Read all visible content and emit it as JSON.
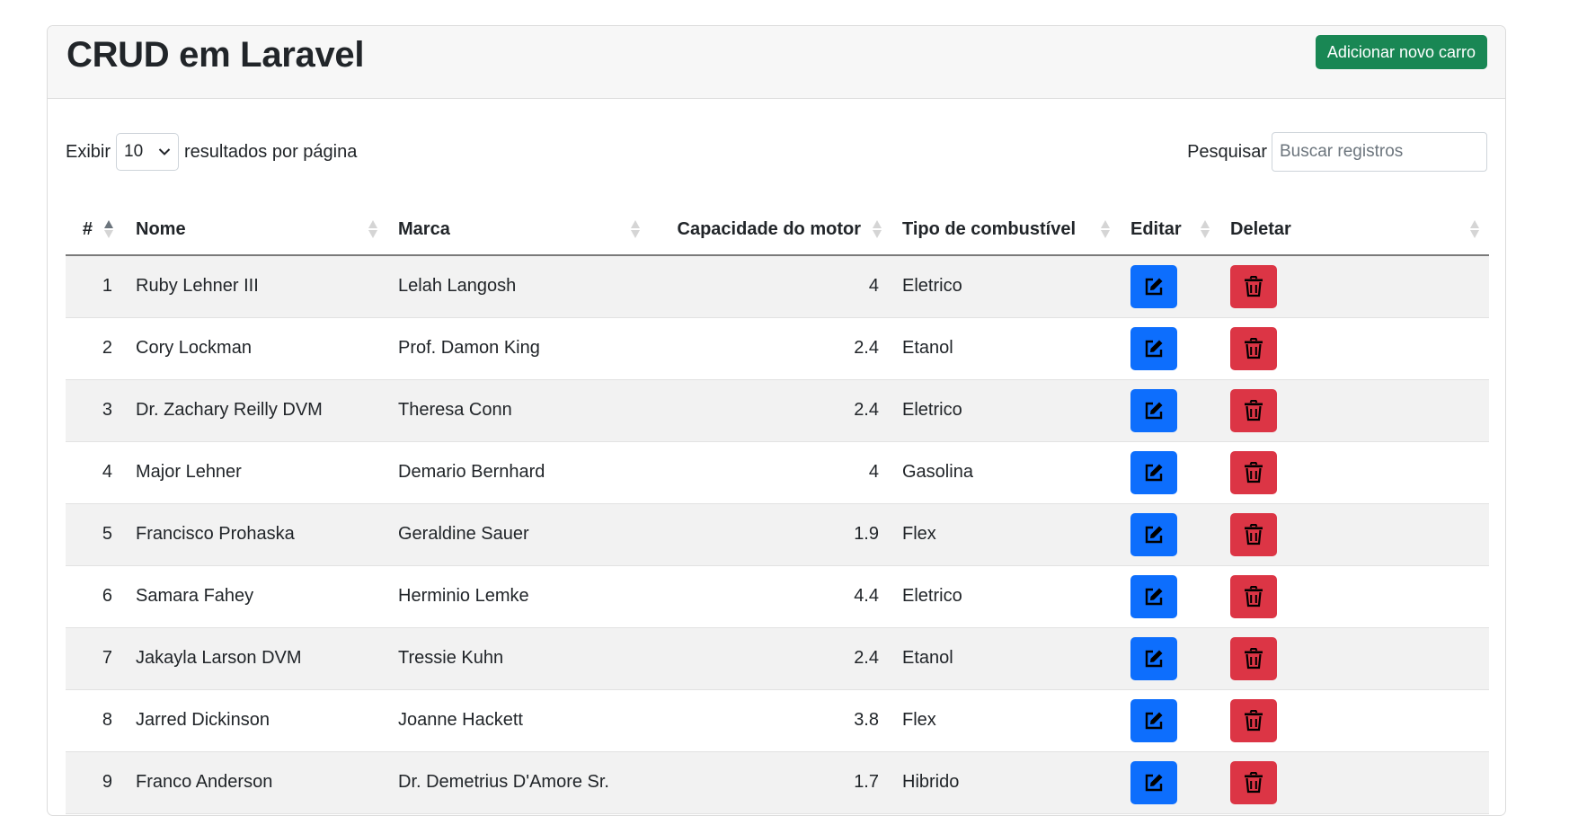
{
  "header": {
    "title": "CRUD em Laravel",
    "add_label": "Adicionar novo carro"
  },
  "controls": {
    "show_prefix": "Exibir",
    "page_length": "10",
    "show_suffix": "resultados por página",
    "search_label": "Pesquisar",
    "search_placeholder": "Buscar registros"
  },
  "table": {
    "columns": [
      "#",
      "Nome",
      "Marca",
      "Capacidade do motor",
      "Tipo de combustível",
      "Editar",
      "Deletar"
    ],
    "rows": [
      [
        "1",
        "Ruby Lehner III",
        "Lelah Langosh",
        "4",
        "Eletrico"
      ],
      [
        "2",
        "Cory Lockman",
        "Prof. Damon King",
        "2.4",
        "Etanol"
      ],
      [
        "3",
        "Dr. Zachary Reilly DVM",
        "Theresa Conn",
        "2.4",
        "Eletrico"
      ],
      [
        "4",
        "Major Lehner",
        "Demario Bernhard",
        "4",
        "Gasolina"
      ],
      [
        "5",
        "Francisco Prohaska",
        "Geraldine Sauer",
        "1.9",
        "Flex"
      ],
      [
        "6",
        "Samara Fahey",
        "Herminio Lemke",
        "4.4",
        "Eletrico"
      ],
      [
        "7",
        "Jakayla Larson DVM",
        "Tressie Kuhn",
        "2.4",
        "Etanol"
      ],
      [
        "8",
        "Jarred Dickinson",
        "Joanne Hackett",
        "3.8",
        "Flex"
      ],
      [
        "9",
        "Franco Anderson",
        "Dr. Demetrius D'Amore Sr.",
        "1.7",
        "Hibrido"
      ]
    ]
  },
  "icons": {
    "edit": "edit-icon",
    "delete": "trash-icon",
    "sort": "sort-icon",
    "select_caret": "chevron-down-icon"
  },
  "colors": {
    "success": "#198754",
    "primary": "#0d6efd",
    "danger": "#dc3545"
  }
}
